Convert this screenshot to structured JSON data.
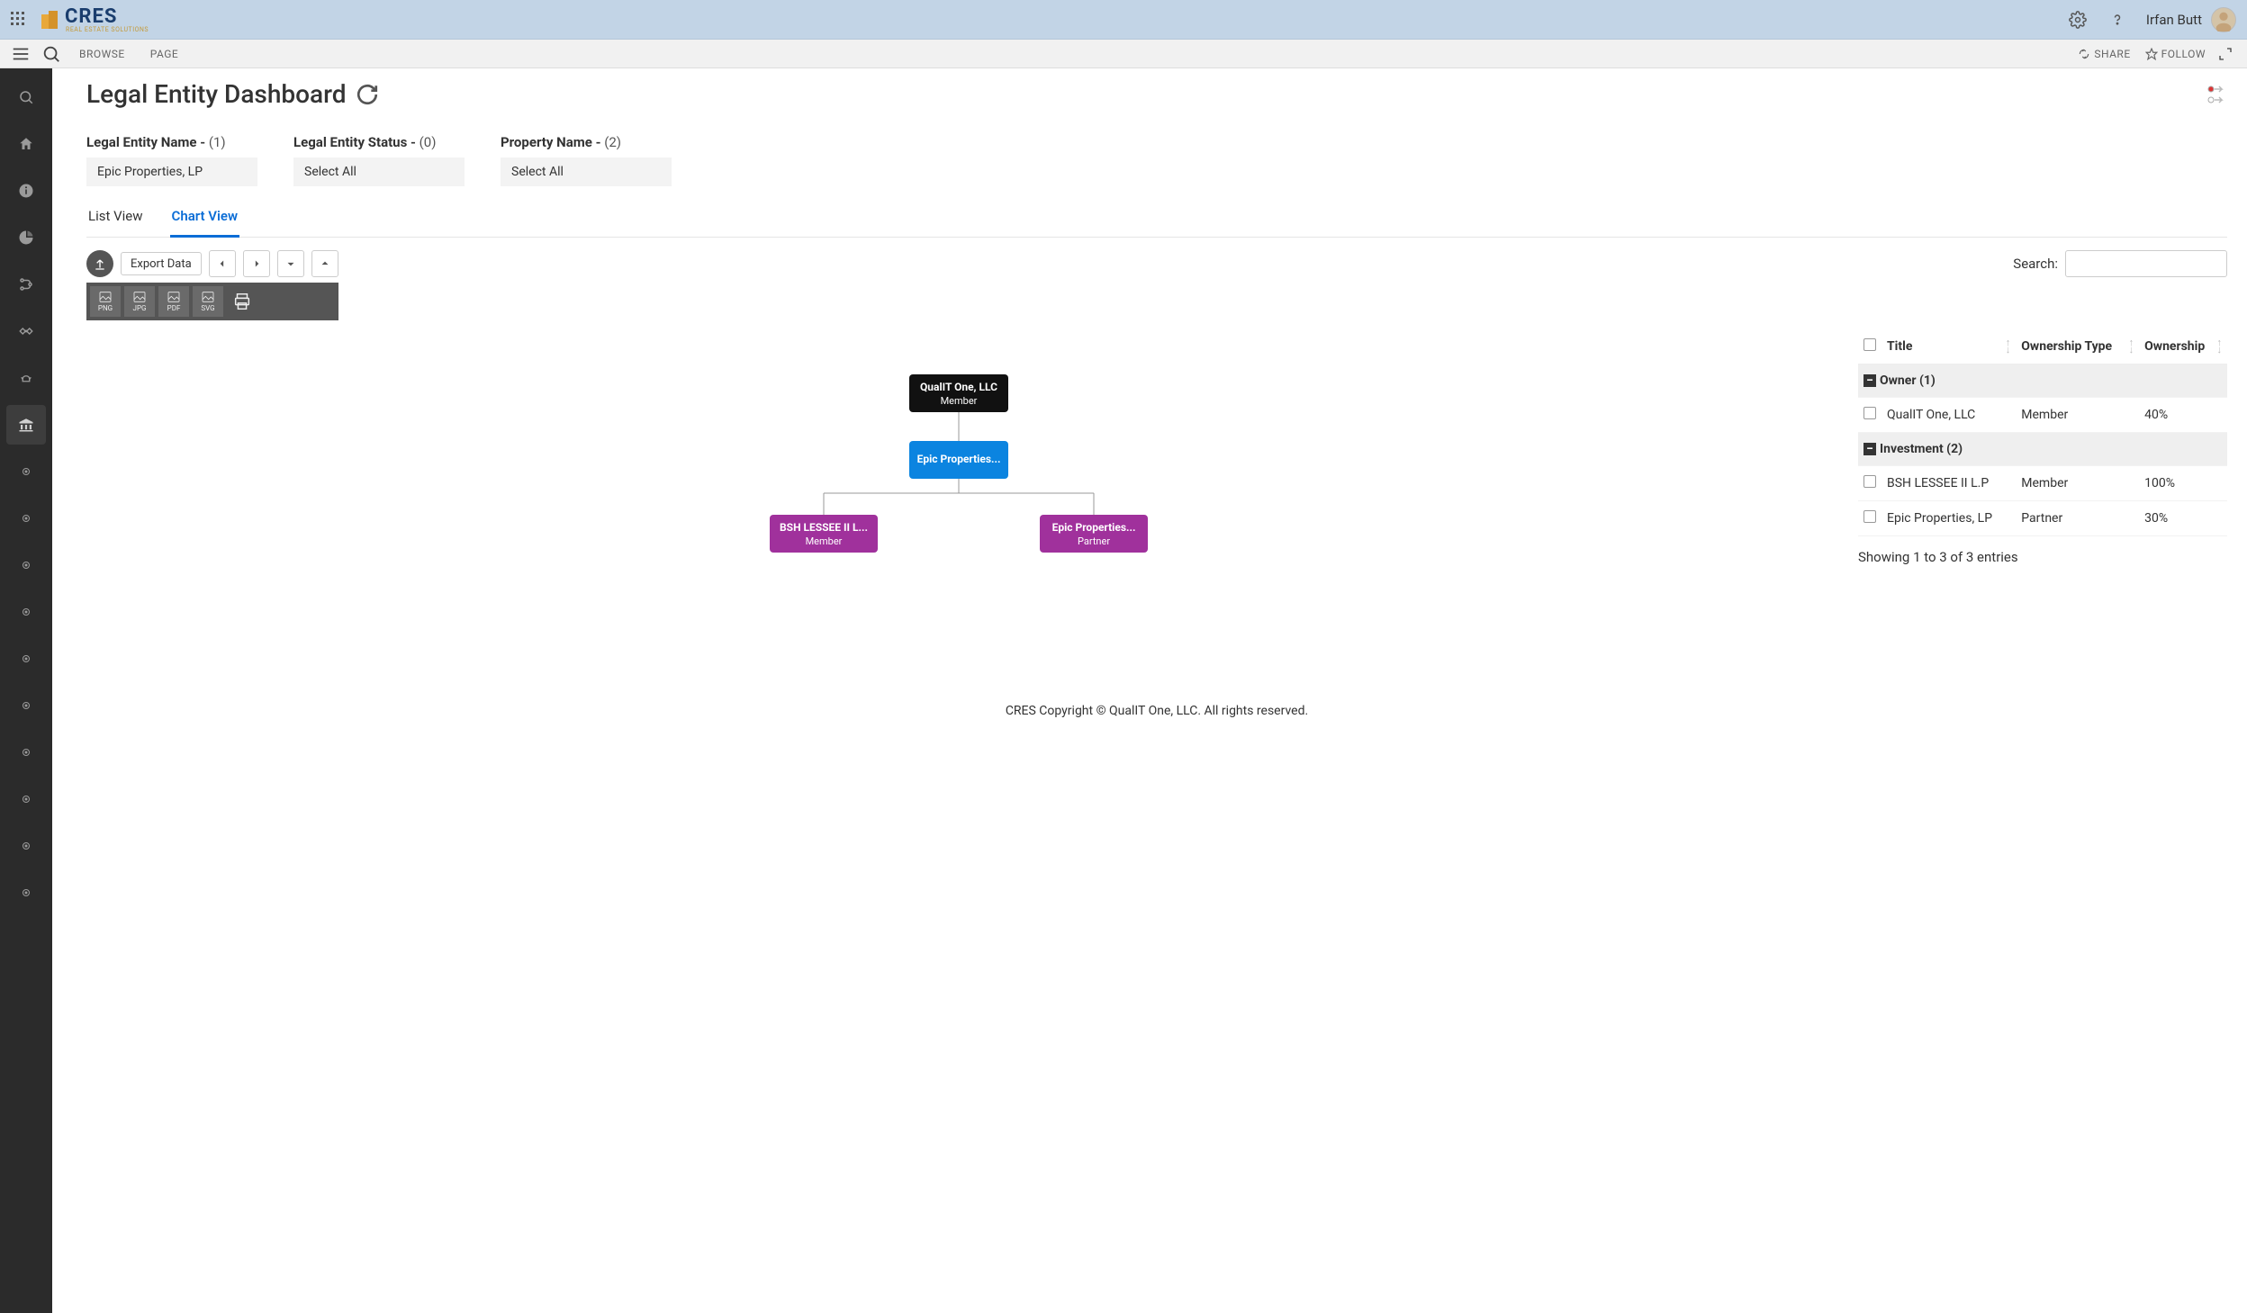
{
  "header": {
    "logo_text": "CRES",
    "logo_sub": "REAL ESTATE SOLUTIONS",
    "username": "Irfan Butt"
  },
  "ribbon": {
    "browse": "BROWSE",
    "page": "PAGE",
    "share": "SHARE",
    "follow": "FOLLOW"
  },
  "page": {
    "title": "Legal Entity Dashboard"
  },
  "filters": [
    {
      "label": "Legal Entity Name",
      "count": "(1)",
      "value": "Epic Properties, LP"
    },
    {
      "label": "Legal Entity Status",
      "count": "(0)",
      "value": "Select All"
    },
    {
      "label": "Property Name",
      "count": "(2)",
      "value": "Select All"
    }
  ],
  "tabs": {
    "list": "List View",
    "chart": "Chart View"
  },
  "toolbar": {
    "export_data": "Export Data",
    "formats": [
      "PNG",
      "JPG",
      "PDF",
      "SVG"
    ]
  },
  "search": {
    "label": "Search:"
  },
  "chart": {
    "nodes": {
      "root": {
        "title": "QualIT One, LLC",
        "subtitle": "Member"
      },
      "mid": {
        "title": "Epic Properties...",
        "subtitle": ""
      },
      "leaf1": {
        "title": "BSH LESSEE II L...",
        "subtitle": "Member"
      },
      "leaf2": {
        "title": "Epic Properties...",
        "subtitle": "Partner"
      }
    }
  },
  "table": {
    "columns": {
      "title": "Title",
      "type": "Ownership Type",
      "ownership": "Ownership"
    },
    "groups": [
      {
        "name": "Owner (1)",
        "rows": [
          {
            "title": "QualIT One, LLC",
            "type": "Member",
            "ownership": "40%"
          }
        ]
      },
      {
        "name": "Investment (2)",
        "rows": [
          {
            "title": "BSH LESSEE II L.P",
            "type": "Member",
            "ownership": "100%"
          },
          {
            "title": "Epic Properties, LP",
            "type": "Partner",
            "ownership": "30%"
          }
        ]
      }
    ],
    "footer": "Showing 1 to 3 of 3 entries"
  },
  "footer": {
    "text": "CRES Copyright © QualIT One, LLC. All rights reserved."
  }
}
